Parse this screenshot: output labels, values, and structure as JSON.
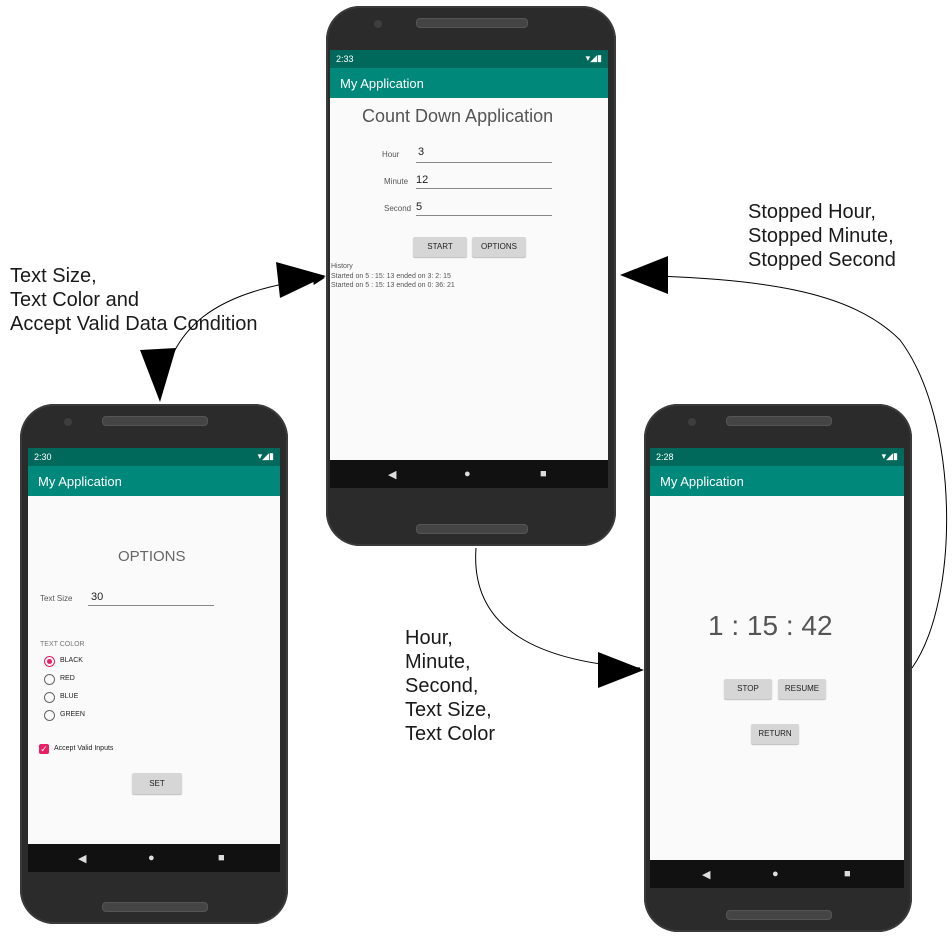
{
  "annotations": {
    "left": [
      "Text Size,",
      "Text Color and",
      "Accept Valid Data Condition"
    ],
    "right": [
      "Stopped Hour,",
      "Stopped Minute,",
      "Stopped Second"
    ],
    "bottom": [
      "Hour,",
      "Minute,",
      "Second,",
      "Text Size,",
      "Text Color"
    ]
  },
  "app_title": "My Application",
  "main_screen": {
    "time": "2:33",
    "heading": "Count Down Application",
    "fields": [
      {
        "label": "Hour",
        "value": "3"
      },
      {
        "label": "Minute",
        "value": "12"
      },
      {
        "label": "Second",
        "value": "5"
      }
    ],
    "start_label": "START",
    "options_label": "OPTIONS",
    "history_title": "History",
    "history": [
      "Started on 5 : 15: 13 ended on 3: 2: 15",
      "Started on 5 : 15: 13 ended on 0: 36: 21"
    ]
  },
  "options_screen": {
    "time": "2:30",
    "heading": "OPTIONS",
    "text_size_label": "Text Size",
    "text_size_value": "30",
    "text_color_label": "TEXT COLOR",
    "colors": [
      "BLACK",
      "RED",
      "BLUE",
      "GREEN"
    ],
    "selected_color": "BLACK",
    "accept_label": "Accept Valid Inputs",
    "set_label": "SET"
  },
  "timer_screen": {
    "time": "2:28",
    "countdown": "1 : 15 : 42",
    "stop_label": "STOP",
    "resume_label": "RESUME",
    "return_label": "RETURN"
  },
  "colors": {
    "status_bar": "#00695c",
    "app_bar": "#00897b",
    "accent": "#e91e63"
  }
}
